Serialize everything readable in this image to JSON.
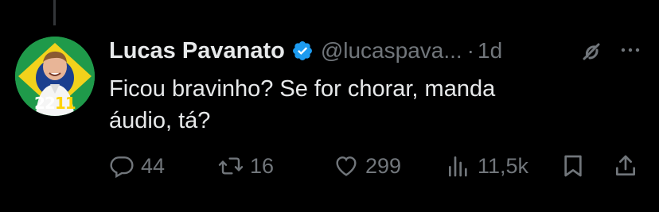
{
  "tweet": {
    "display_name": "Lucas Pavanato",
    "handle": "@lucaspava...",
    "separator": "·",
    "time": "1d",
    "text": "Ficou bravinho? Se for chorar, manda áudio, tá?",
    "verified": true
  },
  "avatar": {
    "badge_number_part1": "22",
    "badge_number_part2": "11"
  },
  "actions": {
    "replies": "44",
    "retweets": "16",
    "likes": "299",
    "views": "11,5k"
  },
  "icons": {
    "verified": "verified-badge-icon",
    "grok": "grok-icon",
    "more": "more-icon",
    "reply": "reply-icon",
    "retweet": "retweet-icon",
    "like": "heart-icon",
    "views": "views-icon",
    "bookmark": "bookmark-icon",
    "share": "share-icon"
  },
  "colors": {
    "background": "#000000",
    "text_primary": "#e7e9ea",
    "text_secondary": "#71767b",
    "verified_blue": "#1d9bf0"
  }
}
